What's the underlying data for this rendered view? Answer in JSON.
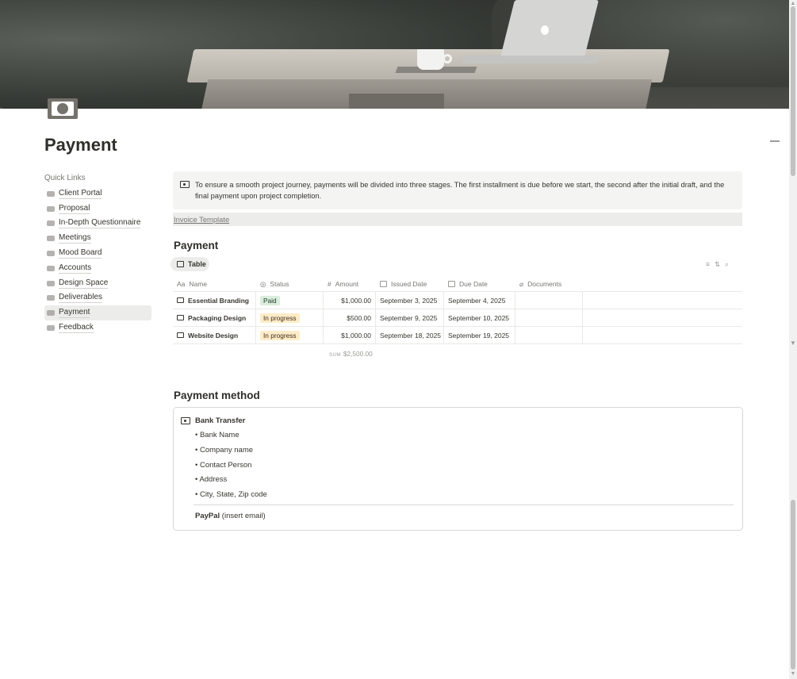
{
  "page": {
    "title": "Payment",
    "cover_description_icon": "cover-image",
    "page_icon": "money-icon"
  },
  "sidebar": {
    "heading": "Quick Links",
    "items": [
      {
        "label": "Client Portal",
        "icon": "link-icon"
      },
      {
        "label": "Proposal",
        "icon": "link-icon"
      },
      {
        "label": "In-Depth Questionnaire",
        "icon": "link-icon"
      },
      {
        "label": "Meetings",
        "icon": "link-icon"
      },
      {
        "label": "Mood Board",
        "icon": "link-icon"
      },
      {
        "label": "Accounts",
        "icon": "link-icon"
      },
      {
        "label": "Design Space",
        "icon": "link-icon"
      },
      {
        "label": "Deliverables",
        "icon": "link-icon"
      },
      {
        "label": "Payment",
        "icon": "link-icon",
        "active": true
      },
      {
        "label": "Feedback",
        "icon": "link-icon"
      }
    ]
  },
  "callout": {
    "text": "To ensure a smooth project journey, payments will be divided into three stages. The first installment is due before we start, the second after the initial draft, and the final payment upon project completion."
  },
  "invoice_link": "Invoice Template",
  "payment_section": {
    "heading": "Payment",
    "view_tab": "Table",
    "columns": [
      "Name",
      "Status",
      "Amount",
      "Issued Date",
      "Due Date",
      "Documents"
    ],
    "column_icons": [
      "Aa",
      "status-icon",
      "#",
      "calendar-icon",
      "calendar-icon",
      "paperclip-icon"
    ],
    "rows": [
      {
        "name": "Essential Branding",
        "status": "Paid",
        "amount": "$1,000.00",
        "issued": "September 3, 2025",
        "due": "September 4, 2025",
        "documents": ""
      },
      {
        "name": "Packaging Design",
        "status": "In progress",
        "amount": "$500.00",
        "issued": "September 9, 2025",
        "due": "September 10, 2025",
        "documents": ""
      },
      {
        "name": "Website Design",
        "status": "In progress",
        "amount": "$1,000.00",
        "issued": "September 18, 2025",
        "due": "September 19, 2025",
        "documents": ""
      }
    ],
    "sum_label": "SUM",
    "sum_value": "$2,500.00",
    "status_colors": {
      "Paid": "#dbeddb",
      "In progress": "#fdecc8"
    }
  },
  "payment_method": {
    "heading": "Payment method",
    "title": "Bank Transfer",
    "items": [
      "• Bank Name",
      "• Company name",
      "• Contact Person",
      "• Address",
      "• City, State, Zip code"
    ],
    "paypal_label": "PayPal",
    "paypal_note": " (insert email)"
  }
}
